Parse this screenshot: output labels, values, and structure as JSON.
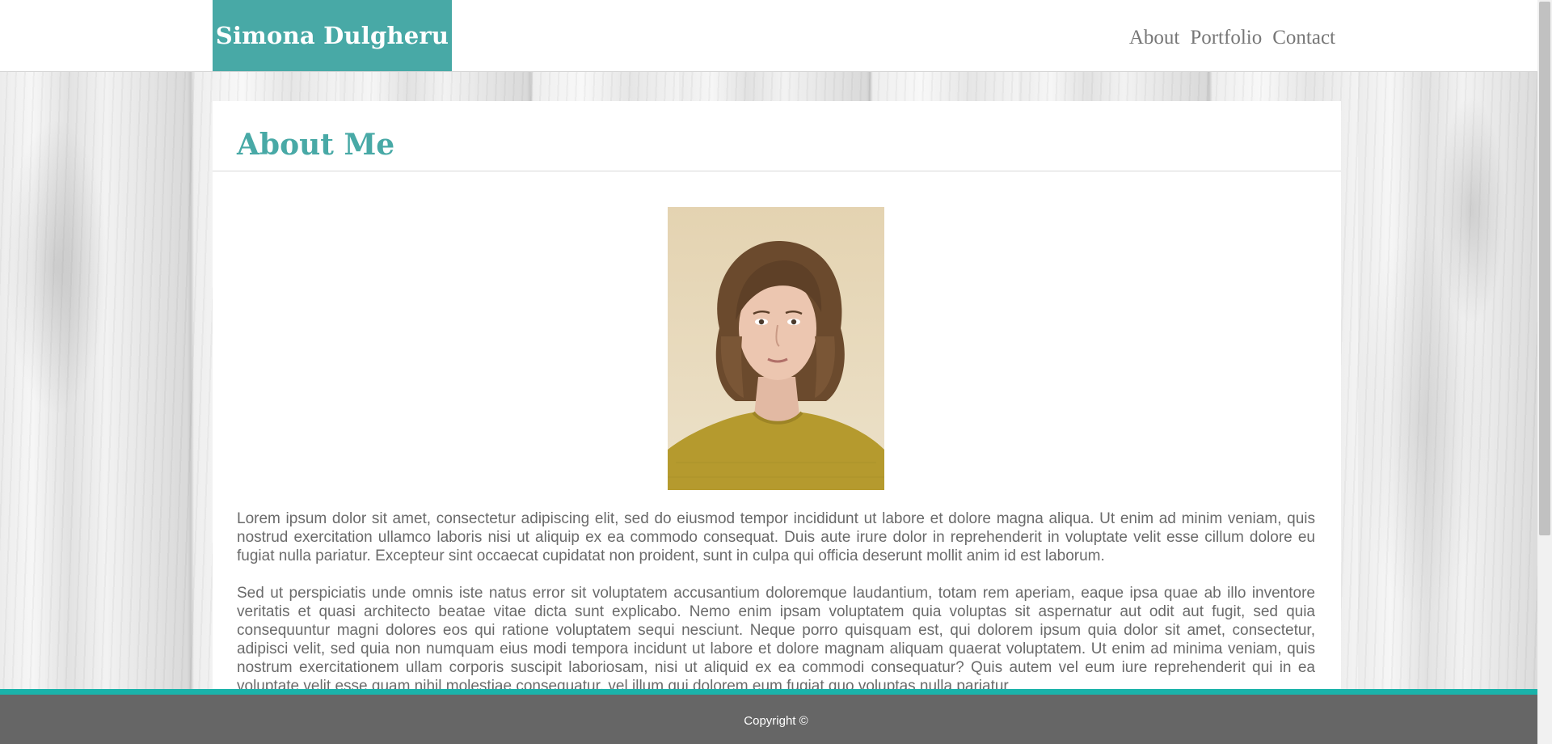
{
  "header": {
    "brand": "Simona Dulgheru",
    "nav": [
      "About",
      "Portfolio",
      "Contact"
    ]
  },
  "main": {
    "title": "About Me",
    "photo_icon": "portrait-photo",
    "paragraphs": [
      "Lorem ipsum dolor sit amet, consectetur adipiscing elit, sed do eiusmod tempor incididunt ut labore et dolore magna aliqua. Ut enim ad minim veniam, quis nostrud exercitation ullamco laboris nisi ut aliquip ex ea commodo consequat. Duis aute irure dolor in reprehenderit in voluptate velit esse cillum dolore eu fugiat nulla pariatur. Excepteur sint occaecat cupidatat non proident, sunt in culpa qui officia deserunt mollit anim id est laborum.",
      "Sed ut perspiciatis unde omnis iste natus error sit voluptatem accusantium doloremque laudantium, totam rem aperiam, eaque ipsa quae ab illo inventore veritatis et quasi architecto beatae vitae dicta sunt explicabo. Nemo enim ipsam voluptatem quia voluptas sit aspernatur aut odit aut fugit, sed quia consequuntur magni dolores eos qui ratione voluptatem sequi nesciunt. Neque porro quisquam est, qui dolorem ipsum quia dolor sit amet, consectetur, adipisci velit, sed quia non numquam eius modi tempora incidunt ut labore et dolore magnam aliquam quaerat voluptatem. Ut enim ad minima veniam, quis nostrum exercitationem ullam corporis suscipit laboriosam, nisi ut aliquid ex ea commodi consequatur? Quis autem vel eum iure reprehenderit qui in ea voluptate velit esse quam nihil molestiae consequatur, vel illum qui dolorem eum fugiat quo voluptas nulla pariatur"
    ]
  },
  "footer": {
    "copyright": "Copyright ©"
  },
  "colors": {
    "brand": "#48a9a6",
    "footer_accent": "#1ab3aa",
    "footer_bg": "#666666",
    "nav_text": "#777777",
    "body_text": "#6a6a6a"
  }
}
